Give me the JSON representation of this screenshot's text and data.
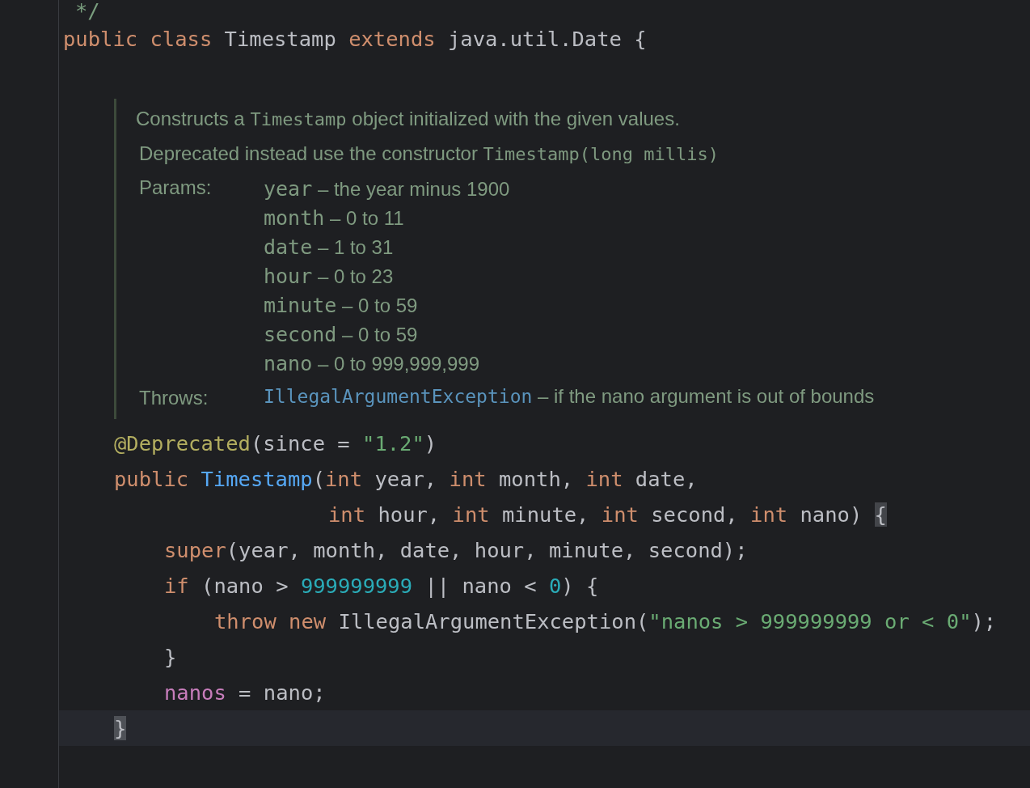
{
  "code_top": [
    {
      "current": false,
      "kind": "member",
      "tokens": [
        {
          "kind": "comment",
          "text": "*/"
        }
      ]
    },
    {
      "current": false,
      "kind": "top",
      "tokens": [
        {
          "kind": "keyword",
          "text": "public class "
        },
        {
          "kind": "plain",
          "text": "Timestamp "
        },
        {
          "kind": "keyword",
          "text": "extends "
        },
        {
          "kind": "plain",
          "text": "java.util.Date {"
        }
      ]
    },
    {
      "current": false,
      "kind": "top"
    }
  ],
  "doc_comment": {
    "summary": [
      {
        "kind": "text",
        "text": "Constructs a "
      },
      {
        "kind": "code",
        "text": "Timestamp"
      },
      {
        "kind": "text",
        "text": " object initialized with the given values."
      }
    ],
    "deprecated": [
      {
        "kind": "text",
        "text": "Deprecated instead use the constructor "
      },
      {
        "kind": "code",
        "text": "Timestamp(long millis)"
      }
    ],
    "params_label": "Params:",
    "params": [
      {
        "name": "year",
        "desc": " – the year minus 1900"
      },
      {
        "name": "month",
        "desc": " – 0 to 11"
      },
      {
        "name": "date",
        "desc": " – 1 to 31"
      },
      {
        "name": "hour",
        "desc": " – 0 to 23"
      },
      {
        "name": "minute",
        "desc": " – 0 to 59"
      },
      {
        "name": "second",
        "desc": " – 0 to 59"
      },
      {
        "name": "nano",
        "desc": " – 0 to 999,999,999"
      }
    ],
    "throws_label": "Throws:",
    "throws": {
      "exception": "IllegalArgumentException",
      "desc": " – if the nano argument is out of bounds"
    }
  },
  "code_bottom": [
    {
      "current": false,
      "kind": "member",
      "tokens": [
        {
          "kind": "annotation",
          "text": "@Deprecated"
        },
        {
          "kind": "plain",
          "text": "(since = "
        },
        {
          "kind": "string",
          "text": "\"1.2\""
        },
        {
          "kind": "plain",
          "text": ")"
        }
      ]
    },
    {
      "current": false,
      "kind": "member",
      "tokens": [
        {
          "kind": "keyword",
          "text": "public "
        },
        {
          "kind": "method",
          "text": "Timestamp"
        },
        {
          "kind": "plain",
          "text": "("
        },
        {
          "kind": "keyword",
          "text": "int "
        },
        {
          "kind": "plain",
          "text": "year, "
        },
        {
          "kind": "keyword",
          "text": "int "
        },
        {
          "kind": "plain",
          "text": "month, "
        },
        {
          "kind": "keyword",
          "text": "int "
        },
        {
          "kind": "plain",
          "text": "date,"
        }
      ]
    },
    {
      "current": false,
      "kind": "continuation",
      "tokens": [
        {
          "kind": "keyword",
          "text": "int "
        },
        {
          "kind": "plain",
          "text": "hour, "
        },
        {
          "kind": "keyword",
          "text": "int "
        },
        {
          "kind": "plain",
          "text": "minute, "
        },
        {
          "kind": "keyword",
          "text": "int "
        },
        {
          "kind": "plain",
          "text": "second, "
        },
        {
          "kind": "keyword",
          "text": "int "
        },
        {
          "kind": "plain",
          "text": "nano) "
        },
        {
          "kind": "brace_match",
          "text": "{"
        }
      ]
    },
    {
      "current": false,
      "kind": "body",
      "tokens": [
        {
          "kind": "keyword",
          "text": "super"
        },
        {
          "kind": "plain",
          "text": "(year, month, date, hour, minute, second);"
        }
      ]
    },
    {
      "current": false,
      "kind": "body",
      "tokens": [
        {
          "kind": "keyword",
          "text": "if "
        },
        {
          "kind": "plain",
          "text": "(nano > "
        },
        {
          "kind": "number",
          "text": "999999999"
        },
        {
          "kind": "plain",
          "text": " || nano < "
        },
        {
          "kind": "number",
          "text": "0"
        },
        {
          "kind": "plain",
          "text": ") {"
        }
      ]
    },
    {
      "current": false,
      "kind": "nested",
      "tokens": [
        {
          "kind": "keyword",
          "text": "throw new "
        },
        {
          "kind": "plain",
          "text": "IllegalArgumentException("
        },
        {
          "kind": "string",
          "text": "\"nanos > 999999999 or < 0\""
        },
        {
          "kind": "plain",
          "text": ");"
        }
      ]
    },
    {
      "current": false,
      "kind": "body",
      "tokens": [
        {
          "kind": "plain",
          "text": "}"
        }
      ]
    },
    {
      "current": false,
      "kind": "body",
      "tokens": [
        {
          "kind": "field",
          "text": "nanos"
        },
        {
          "kind": "plain",
          "text": " = nano;"
        }
      ]
    },
    {
      "current": true,
      "kind": "member",
      "tokens": [
        {
          "kind": "caret",
          "text": "}"
        }
      ]
    }
  ]
}
